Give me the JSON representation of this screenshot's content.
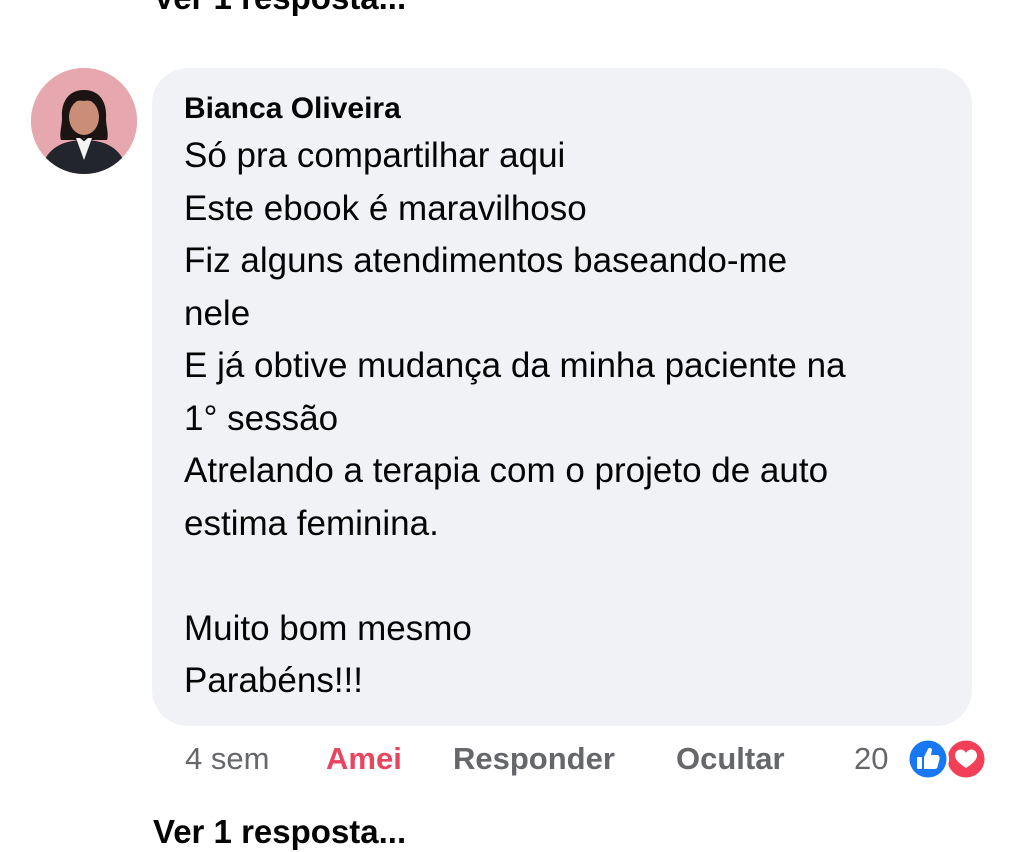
{
  "top_reply_link": "Ver 1 resposta...",
  "comment": {
    "author": "Bianca Oliveira",
    "lines": [
      "Só pra compartilhar aqui",
      "Este ebook é maravilhoso",
      "Fiz alguns atendimentos baseando-me",
      "nele",
      "E já obtive mudança da minha paciente na",
      "1° sessão",
      "Atrelando a terapia com o projeto de auto",
      "estima feminina.",
      "",
      "Muito bom mesmo",
      "Parabéns!!!"
    ],
    "avatar_icon": "user-avatar-photo"
  },
  "actions": {
    "time": "4 sem",
    "reaction_label": "Amei",
    "reply_label": "Responder",
    "hide_label": "Ocultar",
    "reaction_count": "20",
    "reaction_icons": [
      "like-icon",
      "love-icon"
    ]
  },
  "bottom_reply_link": "Ver 1 resposta...",
  "colors": {
    "bubble": "#f0f2f5",
    "text": "#050505",
    "muted": "#65676b",
    "love": "#e84560",
    "like_blue": "#1877f2",
    "love_red": "#f33e58"
  }
}
